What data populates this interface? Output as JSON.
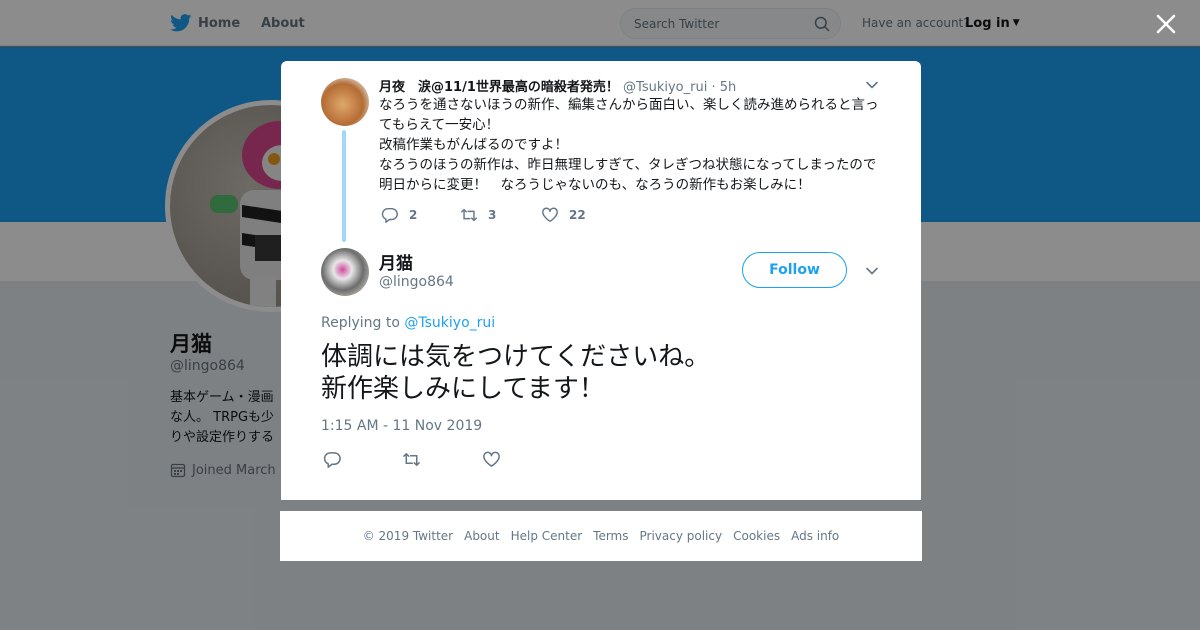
{
  "topbar": {
    "home_label": "Home",
    "about_label": "About",
    "search_placeholder": "Search Twitter",
    "have_account": "Have an account?",
    "login_label": "Log in"
  },
  "profile": {
    "name": "月猫",
    "handle": "@lingo864",
    "bio": "基本ゲーム・漫画\nな人。 TRPGも少\nりや設定作りする",
    "joined": "Joined March"
  },
  "parent_tweet": {
    "name": "月夜　涙@11/1世界最高の暗殺者発売！",
    "handle": "@Tsukiyo_rui",
    "time": "· 5h",
    "text": "なろうを通さないほうの新作、編集さんから面白い、楽しく読み進められると言ってもらえて一安心！\n改稿作業もがんばるのですよ！\nなろうのほうの新作は、昨日無理しすぎて、タレぎつね状態になってしまったので明日からに変更！　なろうじゃないのも、なろうの新作もお楽しみに！",
    "replies": "2",
    "retweets": "3",
    "likes": "22"
  },
  "main_tweet": {
    "name": "月猫",
    "handle": "@lingo864",
    "follow_label": "Follow",
    "replying_prefix": "Replying to",
    "replying_to": "@Tsukiyo_rui",
    "text": "体調には気をつけてくださいね。\n新作楽しみにしてます！",
    "timestamp": "1:15 AM - 11 Nov 2019"
  },
  "footer": {
    "links": [
      "© 2019 Twitter",
      "About",
      "Help Center",
      "Terms",
      "Privacy policy",
      "Cookies",
      "Ads info"
    ]
  },
  "colors": {
    "brand_blue": "#1da1f2",
    "thread_line": "#a2d8f7",
    "secondary_text": "#657786"
  }
}
